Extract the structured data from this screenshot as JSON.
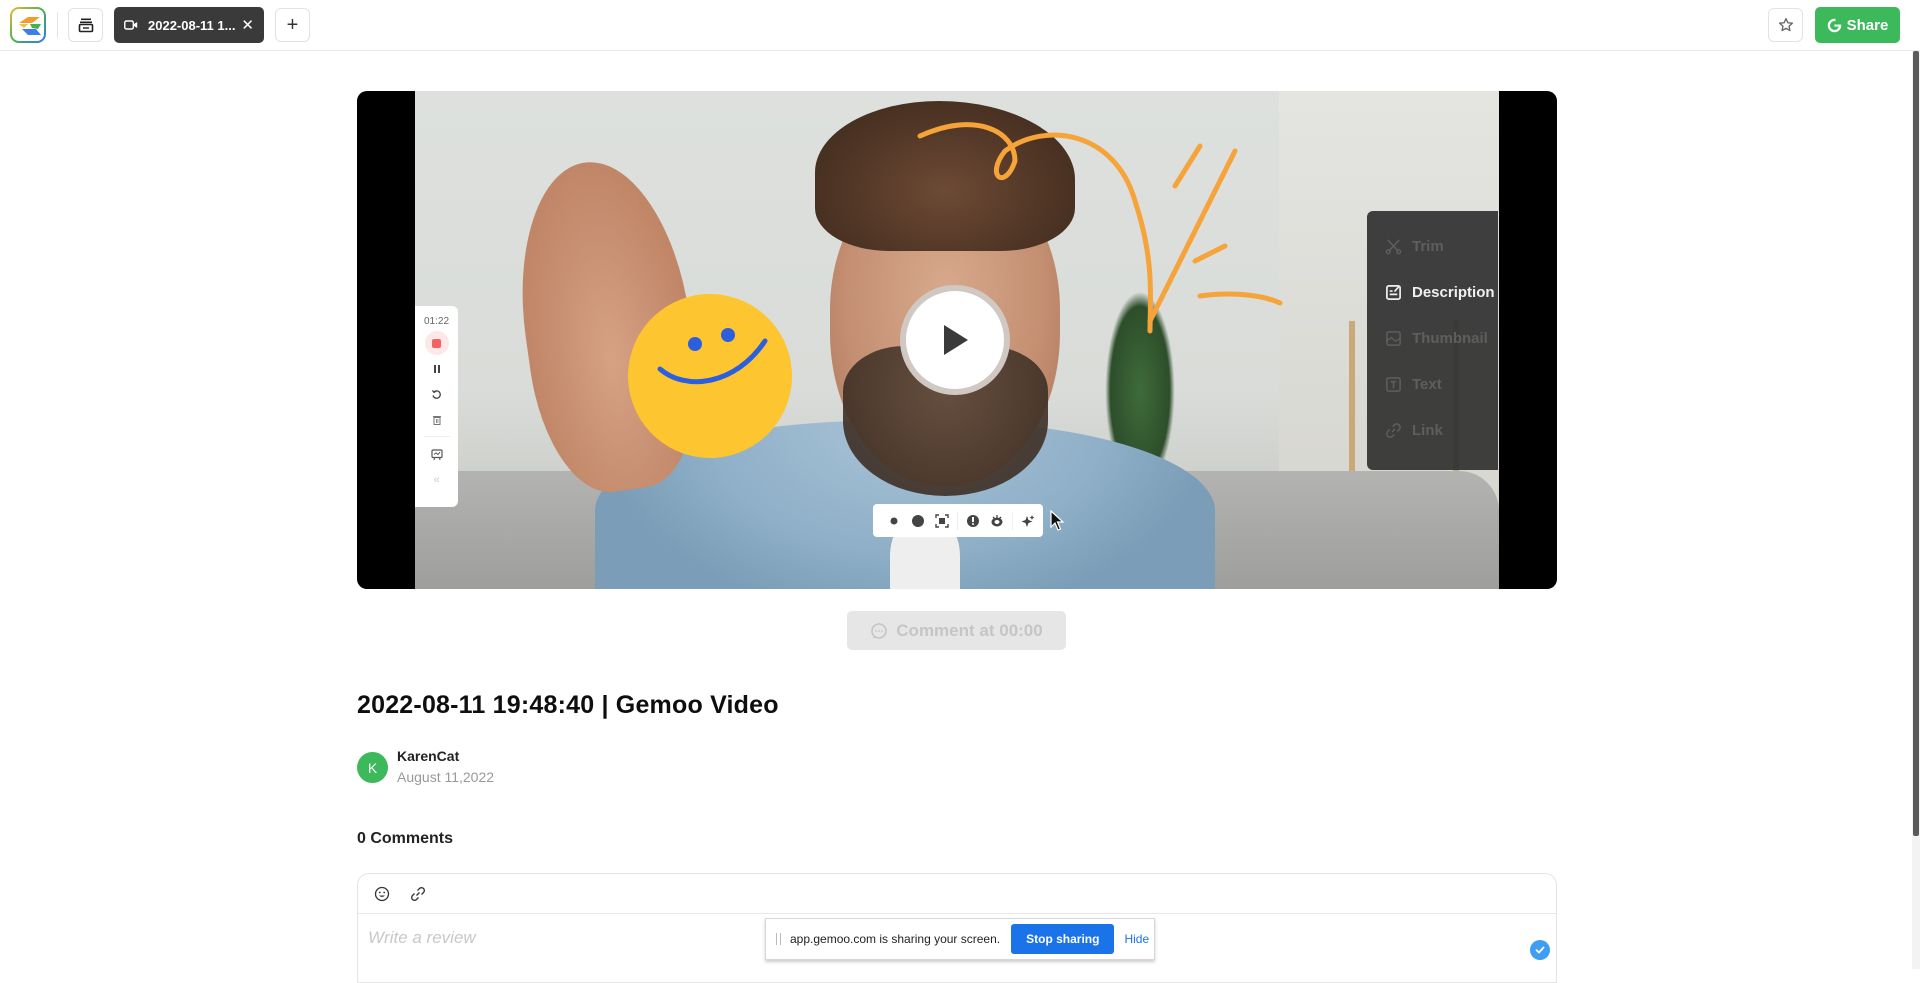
{
  "header": {
    "logo_name": "Gemoo",
    "tab": {
      "label": "2022-08-11 1...",
      "icon": "video-camera-icon"
    },
    "new_tab_label": "+",
    "share_label": "Share",
    "accent_color": "#3cb95a"
  },
  "video": {
    "recorder": {
      "time": "01:22",
      "buttons": [
        "stop",
        "pause",
        "restart",
        "delete",
        "whiteboard",
        "collapse"
      ]
    },
    "edit_menu": [
      {
        "label": "Trim",
        "icon": "scissors-icon",
        "active": false
      },
      {
        "label": "Description",
        "icon": "edit-note-icon",
        "active": true
      },
      {
        "label": "Thumbnail",
        "icon": "image-icon",
        "active": false
      },
      {
        "label": "Text",
        "icon": "text-box-icon",
        "active": false
      },
      {
        "label": "Link",
        "icon": "link-icon",
        "active": false
      }
    ],
    "toolbar": [
      "small-dot",
      "large-dot",
      "screen-focus",
      "spotlight",
      "camera-filter",
      "effects-sparkle"
    ]
  },
  "comment_at_label": "Comment at 00:00",
  "post": {
    "title": "2022-08-11 19:48:40 | Gemoo Video",
    "author": {
      "initial": "K",
      "name": "KarenCat",
      "date": "August 11,2022"
    },
    "comments_count_label": "0 Comments"
  },
  "comment_box": {
    "placeholder": "Write a review"
  },
  "screen_share_bar": {
    "message": "app.gemoo.com is sharing your screen.",
    "stop_label": "Stop sharing",
    "hide_label": "Hide"
  }
}
